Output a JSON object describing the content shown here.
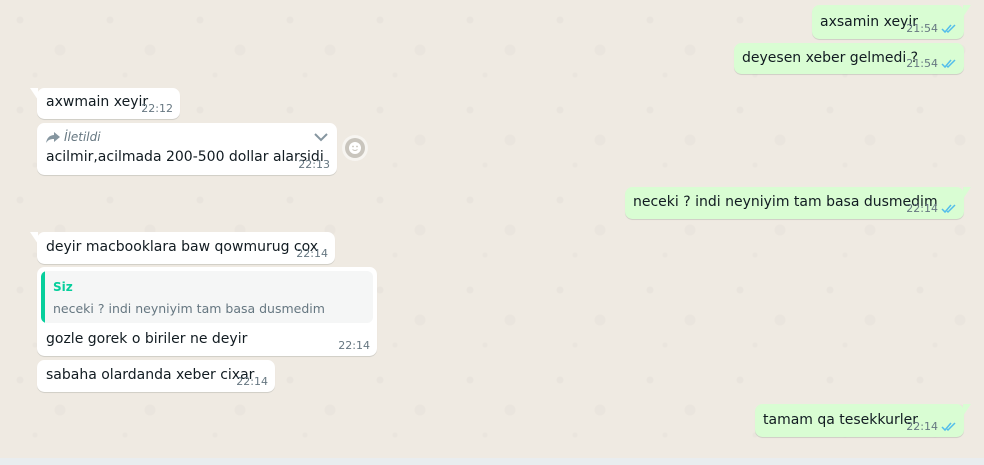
{
  "colors": {
    "wallpaper": "#efeae2",
    "incoming_bubble": "#ffffff",
    "outgoing_bubble": "#d9fdd3",
    "read_ticks": "#53bdeb",
    "quote_accent": "#06cf9c",
    "meta_text": "#667781"
  },
  "messages": [
    {
      "direction": "out",
      "text": "axsamin xeyir",
      "time": "21:54",
      "status": "read"
    },
    {
      "direction": "out",
      "text": "deyesen xeber gelmedi  ?",
      "time": "21:54",
      "status": "read"
    },
    {
      "direction": "in",
      "text": "axwmain xeyir",
      "time": "22:12"
    },
    {
      "direction": "in",
      "forwarded_label": "İletildi",
      "text": "acilmir,acilmada 200-500 dollar alarsidi",
      "time": "22:13",
      "forward_icon": "forward-arrow-icon",
      "menu_icon": "chevron-down-icon",
      "react_icon": "emoji-react-icon"
    },
    {
      "direction": "out",
      "text": "neceki ? indi neyniyim tam basa dusmedim",
      "time": "22:14",
      "status": "read"
    },
    {
      "direction": "in",
      "text": "deyir macbooklara baw qowmurug cox",
      "time": "22:14"
    },
    {
      "direction": "in",
      "quote_author": "Siz",
      "quote_text": "neceki ? indi neyniyim tam basa dusmedim",
      "text": "gozle gorek o biriler ne deyir",
      "time": "22:14"
    },
    {
      "direction": "in",
      "text": "sabaha olardanda xeber cixar",
      "time": "22:14"
    },
    {
      "direction": "out",
      "text": "tamam qa tesekkurler",
      "time": "22:14",
      "status": "read"
    }
  ]
}
